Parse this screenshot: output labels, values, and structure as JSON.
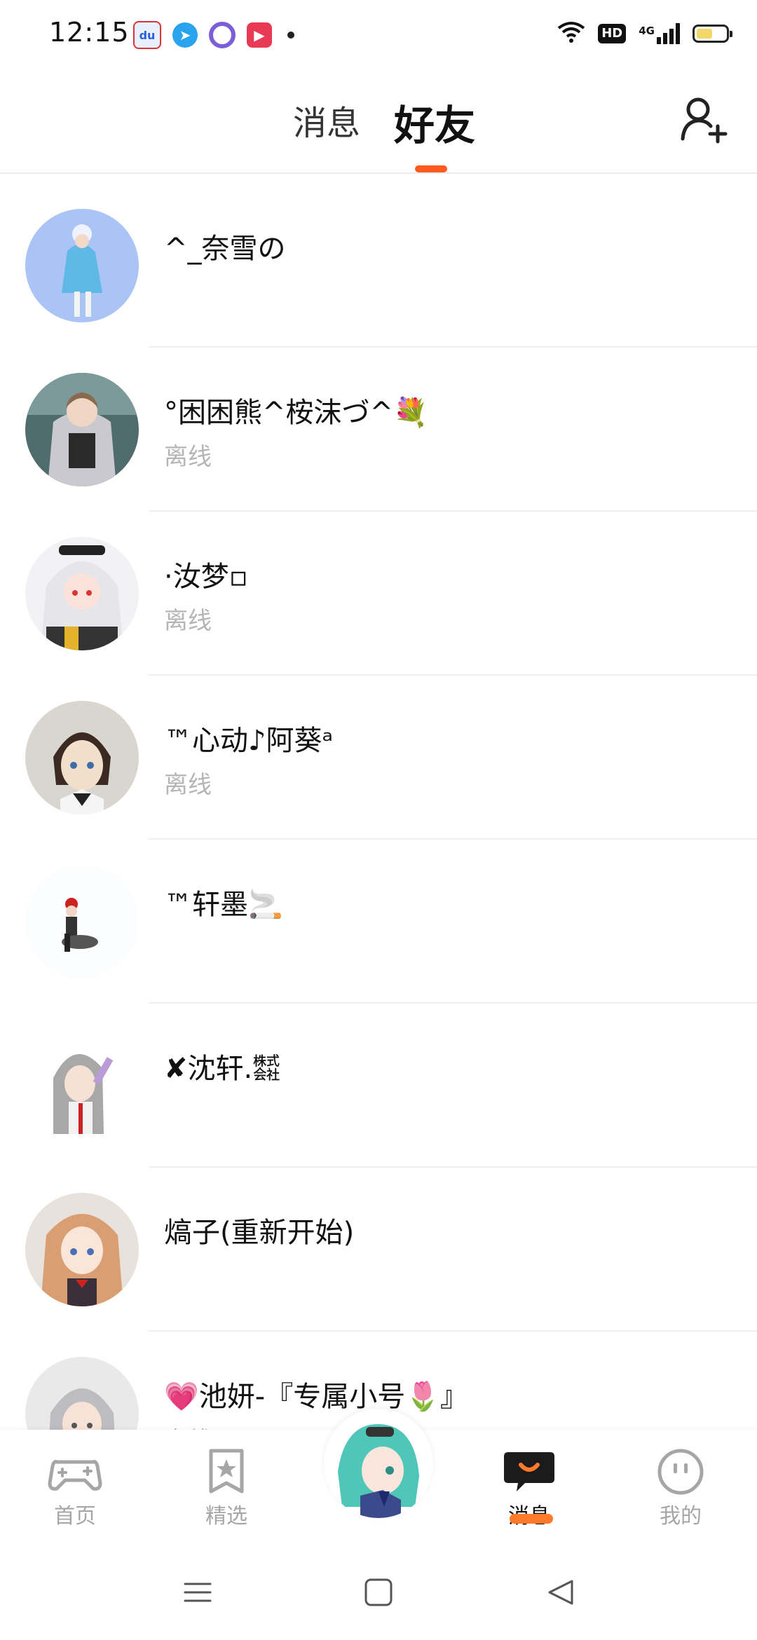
{
  "status_bar": {
    "time": "12:15",
    "network": "4G",
    "hd": "HD",
    "battery_level": 0.55
  },
  "header": {
    "tabs": [
      {
        "label": "消息",
        "active": false
      },
      {
        "label": "好友",
        "active": true
      }
    ],
    "add_friend_icon": "add-user-icon"
  },
  "friends": [
    {
      "name": "^_奈雪の",
      "status": ""
    },
    {
      "name": "°困困熊^桉沫づ^💐",
      "status": "离线"
    },
    {
      "name": "·汝梦▫",
      "status": "离线"
    },
    {
      "name": "™心动♪阿葵ᵃ",
      "status": "离线"
    },
    {
      "name": "™轩墨🚬",
      "status": ""
    },
    {
      "name": "✘沈轩.㍿",
      "status": ""
    },
    {
      "name": "熇子(重新开始)",
      "status": ""
    },
    {
      "name": "💗池妍-『专属小号🌷』",
      "status": "离线"
    }
  ],
  "bottom_nav": {
    "items": [
      {
        "label": "首页",
        "icon": "gamepad-icon",
        "active": false
      },
      {
        "label": "精选",
        "icon": "star-bookmark-icon",
        "active": false
      },
      {
        "label": "消息",
        "icon": "chat-bubble-icon",
        "active": true
      },
      {
        "label": "我的",
        "icon": "face-icon",
        "active": false
      }
    ],
    "center_icon": "avatar-character"
  },
  "colors": {
    "accent": "#ff5a1f",
    "status_gray": "#b5b5b5",
    "nav_gray": "#a6a6a6"
  }
}
